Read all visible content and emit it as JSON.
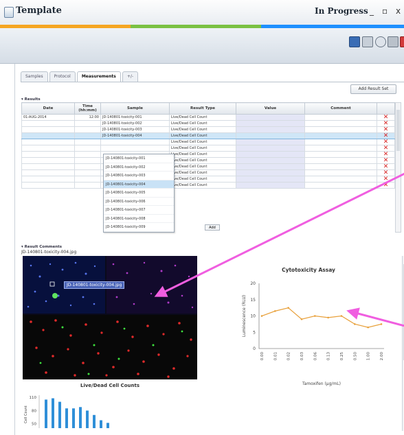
{
  "window": {
    "title": "Template",
    "status": "In Progress",
    "minimize": "_",
    "maximize": "▫",
    "close": "x"
  },
  "tabs": [
    {
      "label": "Samples"
    },
    {
      "label": "Protocol"
    },
    {
      "label": "Measurements",
      "active": true
    },
    {
      "label": "+/-"
    }
  ],
  "results": {
    "section_title": "▾ Results",
    "add_result_set": "Add Result Set",
    "columns": [
      "Date",
      "Time\n(hh:mm)",
      "Sample",
      "Result Type",
      "Value",
      "Comment"
    ],
    "rows": [
      {
        "date": "01-AUG-2014",
        "time": "12:00",
        "sample": "JD-140801-toxicity-001",
        "result_type": "Live/Dead Cell Count"
      },
      {
        "date": "",
        "time": "",
        "sample": "JD-140801-toxicity-002",
        "result_type": "Live/Dead Cell Count"
      },
      {
        "date": "",
        "time": "",
        "sample": "JD-140801-toxicity-003",
        "result_type": "Live/Dead Cell Count"
      },
      {
        "date": "",
        "time": "",
        "sample": "JD-140801-toxicity-004",
        "result_type": "Live/Dead Cell Count",
        "selected": true
      },
      {
        "date": "",
        "time": "",
        "sample": "",
        "result_type": "Live/Dead Cell Count"
      },
      {
        "date": "",
        "time": "",
        "sample": "",
        "result_type": "Live/Dead Cell Count"
      },
      {
        "date": "",
        "time": "",
        "sample": "",
        "result_type": "Live/Dead Cell Count"
      },
      {
        "date": "",
        "time": "",
        "sample": "",
        "result_type": "Live/Dead Cell Count"
      },
      {
        "date": "",
        "time": "",
        "sample": "",
        "result_type": "Live/Dead Cell Count"
      },
      {
        "date": "",
        "time": "",
        "sample": "",
        "result_type": "Live/Dead Cell Count"
      },
      {
        "date": "",
        "time": "",
        "sample": "",
        "result_type": "Live/Dead Cell Count"
      },
      {
        "date": "",
        "time": "",
        "sample": "",
        "result_type": "Live/Dead Cell Count"
      }
    ],
    "dropdown_options": [
      "JD-140801-toxicity-001",
      "JD-140801-toxicity-002",
      "JD-140801-toxicity-003",
      "JD-140801-toxicity-004",
      "JD-140801-toxicity-005",
      "JD-140801-toxicity-006",
      "JD-140801-toxicity-007",
      "JD-140801-toxicity-008",
      "JD-140801-toxicity-009"
    ],
    "dropdown_selected_index": 3,
    "add_label": "Add"
  },
  "comments": {
    "section_title": "▾ Result Comments",
    "image_name": "JD-140801-toxicity-004.jpg",
    "image_label": "JD-140801-toxicity-004.jpg"
  },
  "colors": {
    "stripe": [
      "#f5a623",
      "#7ac143",
      "#1e90ff"
    ],
    "delete_x": "#d62020",
    "value_cell": "#e4e6f6",
    "selected_row": "#cfe6f7",
    "line_series": "#e8a03a",
    "bar_series": "#2f8fd8",
    "arrow": "#f05ee0"
  },
  "chart_data": [
    {
      "type": "line",
      "title": "Cytotoxicity Assay",
      "xlabel": "Tamoxifen (µg/mL)",
      "ylabel": "Luminescence (RLU)",
      "ylim": [
        0,
        20
      ],
      "yticks": [
        0,
        5,
        10,
        15,
        20
      ],
      "x": [
        "0.00",
        "0.01",
        "0.02",
        "0.03",
        "0.06",
        "0.13",
        "0.25",
        "0.50",
        "1.00",
        "2.00"
      ],
      "series": [
        {
          "values": [
            10,
            11.5,
            12.5,
            9,
            10,
            9.5,
            10,
            7.5,
            6.5,
            7.5
          ]
        }
      ],
      "grid": false
    },
    {
      "type": "bar",
      "title": "Live/Dead Cell Counts",
      "ylabel": "Cell Count",
      "yticks": [
        50,
        80,
        110
      ],
      "values": [
        105,
        108,
        100,
        85,
        85,
        88,
        80,
        70,
        58,
        52
      ],
      "grid": false
    }
  ]
}
